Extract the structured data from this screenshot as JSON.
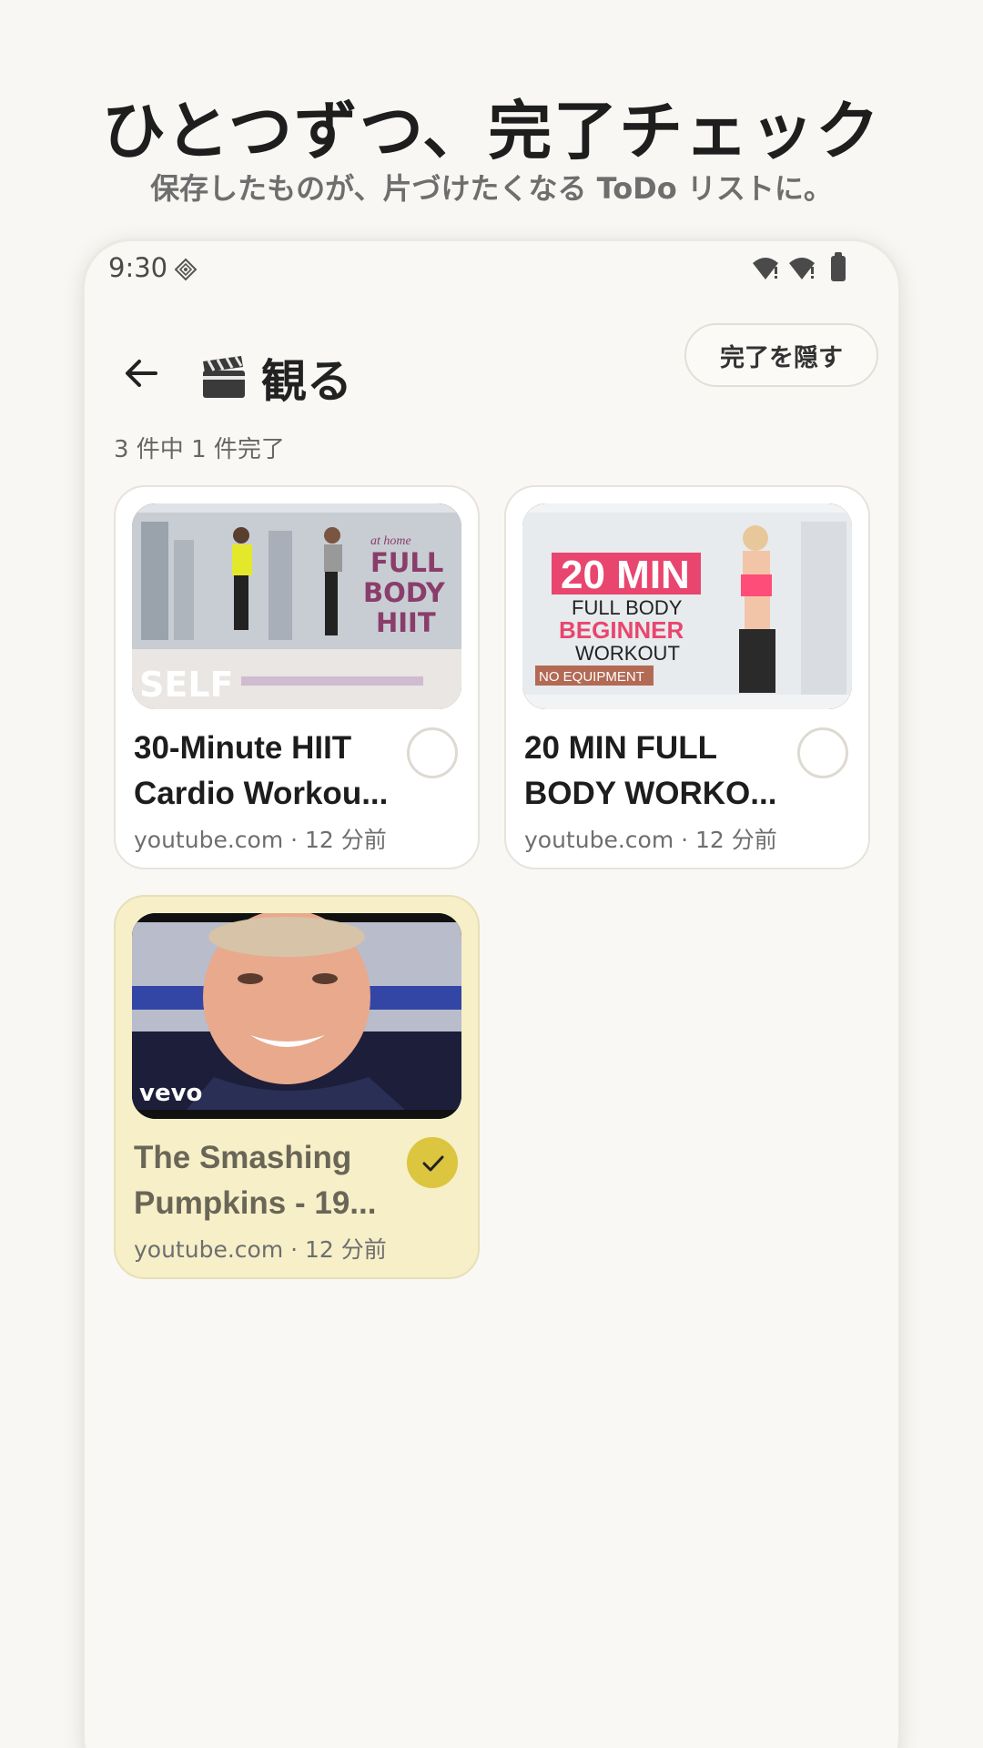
{
  "header": {
    "headline": "ひとつずつ、完了チェック",
    "subline": "保存したものが、片づけたくなる ToDo リストに。"
  },
  "status_bar": {
    "time": "9:30"
  },
  "top_bar": {
    "title_emoji": "clapper-board-icon",
    "title": "観る",
    "hide_button_label": "完了を隠す"
  },
  "progress_text": "3 件中 1 件完了",
  "cards": [
    {
      "title": "30-Minute HIIT Cardio Workou...",
      "meta": "youtube.com · 12 分前",
      "thumb_text": {
        "top": "at home",
        "l1": "FULL",
        "l2": "BODY",
        "l3": "HIIT",
        "brand": "SELF"
      },
      "completed": false
    },
    {
      "title": "20 MIN FULL BODY WORKO...",
      "meta": "youtube.com · 12 分前",
      "thumb_text": {
        "big": "20 MIN",
        "l1": "FULL BODY",
        "l2": "BEGINNER",
        "l3": "WORKOUT",
        "tag": "NO EQUIPMENT"
      },
      "completed": false
    },
    {
      "title": "The Smashing Pumpkins - 19...",
      "meta": "youtube.com · 12 分前",
      "thumb_text": {
        "brand": "vevo"
      },
      "completed": true
    }
  ],
  "colors": {
    "background": "#f8f7f3",
    "completed_card": "#f6efc8",
    "check_accent": "#dcc53f",
    "thumb_pink": "#e8466f"
  }
}
